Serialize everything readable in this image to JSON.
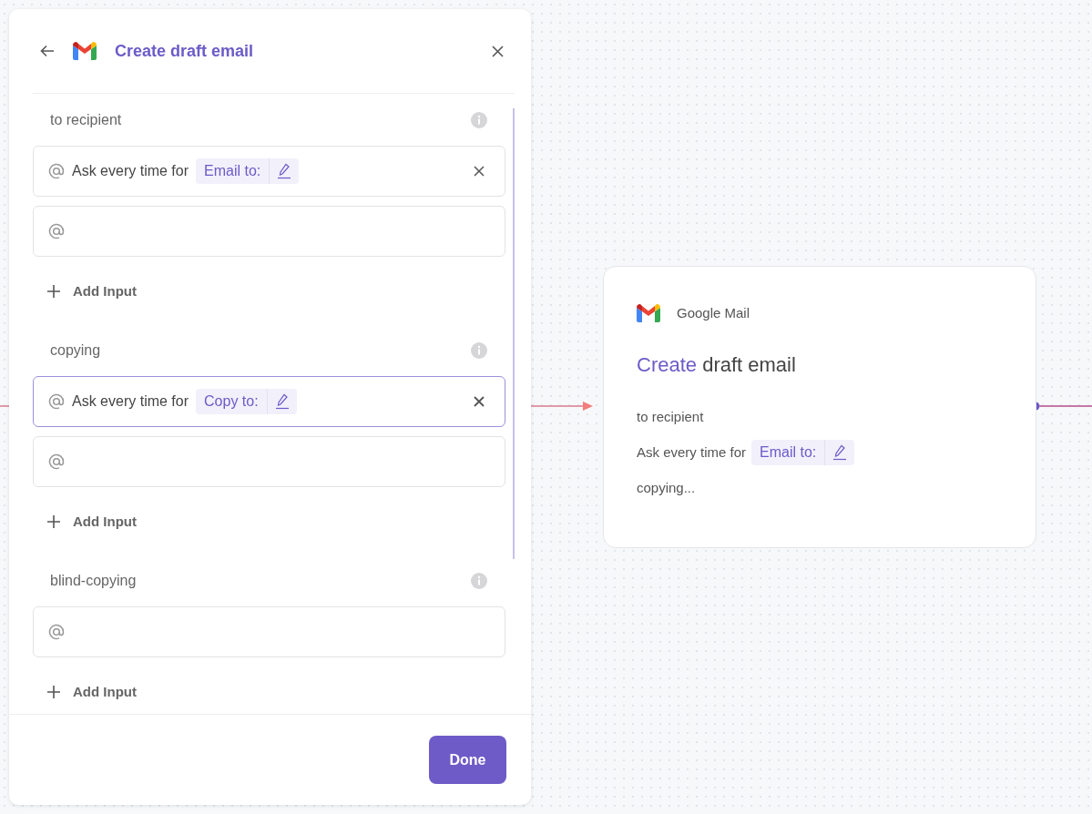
{
  "panel": {
    "title": "Create draft email",
    "sections": [
      {
        "label": "to recipient",
        "entries": [
          {
            "kind": "ask",
            "text": "Ask every time for",
            "tag": "Email to:",
            "focused": false
          },
          {
            "kind": "empty"
          }
        ],
        "add_label": "Add Input"
      },
      {
        "label": "copying",
        "entries": [
          {
            "kind": "ask",
            "text": "Ask every time for",
            "tag": "Copy to:",
            "focused": true
          },
          {
            "kind": "empty"
          }
        ],
        "add_label": "Add Input"
      },
      {
        "label": "blind-copying",
        "entries": [
          {
            "kind": "empty"
          }
        ],
        "add_label": "Add Input"
      }
    ],
    "done_label": "Done"
  },
  "node": {
    "app": "Google Mail",
    "title_action": "Create",
    "title_rest": "draft email",
    "lines": [
      {
        "kind": "label",
        "text": "to recipient"
      },
      {
        "kind": "ask",
        "text": "Ask every time for",
        "tag": "Email to:"
      },
      {
        "kind": "label",
        "text": "copying..."
      }
    ]
  }
}
